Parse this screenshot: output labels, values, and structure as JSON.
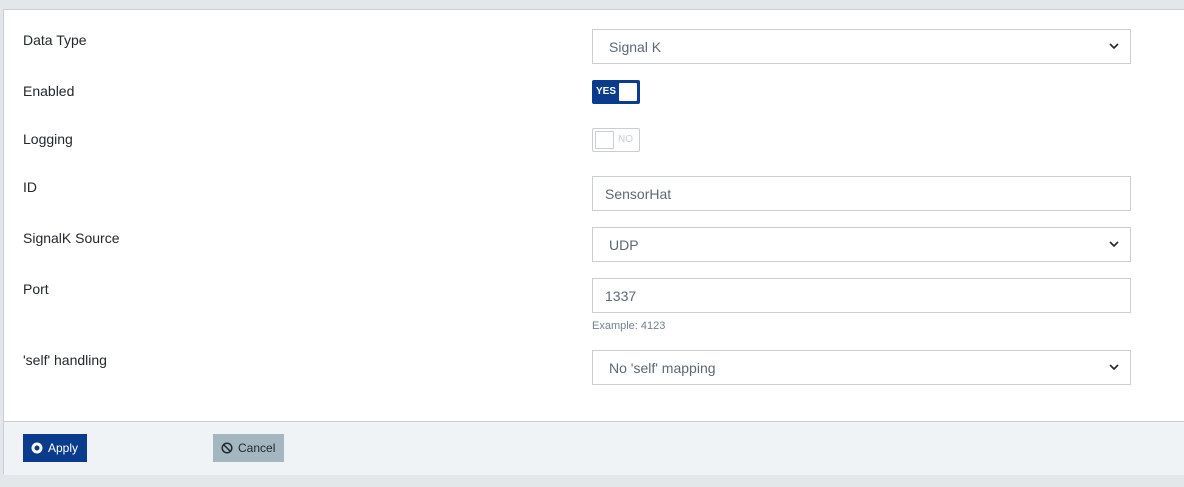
{
  "form": {
    "data_type": {
      "label": "Data Type",
      "value": "Signal K"
    },
    "enabled": {
      "label": "Enabled",
      "state": "YES",
      "on": true
    },
    "logging": {
      "label": "Logging",
      "state": "NO",
      "on": false
    },
    "id": {
      "label": "ID",
      "value": "SensorHat"
    },
    "signalk_source": {
      "label": "SignalK Source",
      "value": "UDP"
    },
    "port": {
      "label": "Port",
      "value": "1337",
      "help": "Example: 4123"
    },
    "self_handling": {
      "label": "'self' handling",
      "value": "No 'self' mapping"
    }
  },
  "footer": {
    "apply_label": "Apply",
    "cancel_label": "Cancel"
  },
  "colors": {
    "primary": "#0b3b8c",
    "secondary": "#a4b7c1"
  },
  "icons": {
    "apply": "dot-circle-icon",
    "cancel": "ban-icon",
    "select": "chevron-down-icon"
  }
}
